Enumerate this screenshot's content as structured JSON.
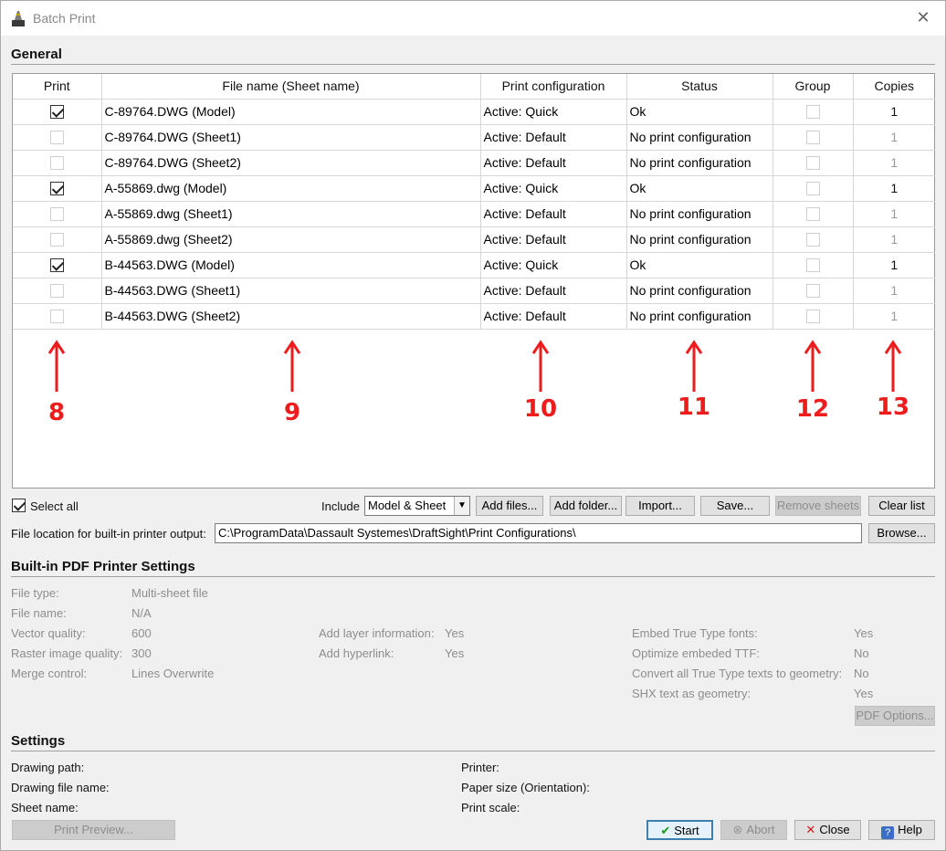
{
  "window": {
    "title": "Batch Print"
  },
  "general": {
    "heading": "General",
    "columns": [
      "Print",
      "File name (Sheet name)",
      "Print configuration",
      "Status",
      "Group",
      "Copies"
    ],
    "rows": [
      {
        "print": true,
        "file": "C-89764.DWG (Model)",
        "config": "Active: Quick",
        "status": "Ok",
        "copies": "1"
      },
      {
        "print": false,
        "file": "C-89764.DWG (Sheet1)",
        "config": "Active: Default",
        "status": "No print configuration",
        "copies": "1"
      },
      {
        "print": false,
        "file": "C-89764.DWG (Sheet2)",
        "config": "Active: Default",
        "status": "No print configuration",
        "copies": "1"
      },
      {
        "print": true,
        "file": "A-55869.dwg (Model)",
        "config": "Active: Quick",
        "status": "Ok",
        "copies": "1"
      },
      {
        "print": false,
        "file": "A-55869.dwg (Sheet1)",
        "config": "Active: Default",
        "status": "No print configuration",
        "copies": "1"
      },
      {
        "print": false,
        "file": "A-55869.dwg (Sheet2)",
        "config": "Active: Default",
        "status": "No print configuration",
        "copies": "1"
      },
      {
        "print": true,
        "file": "B-44563.DWG (Model)",
        "config": "Active: Quick",
        "status": "Ok",
        "copies": "1"
      },
      {
        "print": false,
        "file": "B-44563.DWG (Sheet1)",
        "config": "Active: Default",
        "status": "No print configuration",
        "copies": "1"
      },
      {
        "print": false,
        "file": "B-44563.DWG (Sheet2)",
        "config": "Active: Default",
        "status": "No print configuration",
        "copies": "1"
      }
    ],
    "annotations": [
      "8",
      "9",
      "10",
      "11",
      "12",
      "13"
    ],
    "select_all_label": "Select all",
    "include_label": "Include",
    "include_value": "Model & Sheet",
    "buttons": {
      "add_files": "Add files...",
      "add_folder": "Add folder...",
      "import": "Import...",
      "save": "Save...",
      "remove_sheets": "Remove sheets",
      "clear_list": "Clear list"
    },
    "file_location_label": "File location for built-in printer output:",
    "file_location_value": "C:\\ProgramData\\Dassault Systemes\\DraftSight\\Print Configurations\\",
    "browse": "Browse..."
  },
  "pdf": {
    "heading": "Built-in PDF Printer Settings",
    "col1": [
      {
        "label": "File type:",
        "value": "Multi-sheet file"
      },
      {
        "label": "File name:",
        "value": "N/A"
      },
      {
        "label": "Vector quality:",
        "value": "600"
      },
      {
        "label": "Raster image quality:",
        "value": "300"
      },
      {
        "label": "Merge control:",
        "value": "Lines Overwrite"
      }
    ],
    "col2": [
      {
        "label": "Add layer information:",
        "value": "Yes"
      },
      {
        "label": "Add hyperlink:",
        "value": "Yes"
      }
    ],
    "col3": [
      {
        "label": "Embed True Type fonts:",
        "value": "Yes"
      },
      {
        "label": "Optimize embeded TTF:",
        "value": "No"
      },
      {
        "label": "Convert all True Type texts to geometry:",
        "value": "No"
      },
      {
        "label": "SHX text as geometry:",
        "value": "Yes"
      }
    ],
    "options_button": "PDF Options..."
  },
  "settings": {
    "heading": "Settings",
    "left": [
      "Drawing path:",
      "Drawing file name:",
      "Sheet name:"
    ],
    "right": [
      "Printer:",
      "Paper size (Orientation):",
      "Print scale:"
    ],
    "print_preview": "Print Preview..."
  },
  "footer": {
    "start": "Start",
    "abort": "Abort",
    "close": "Close",
    "help": "Help"
  }
}
